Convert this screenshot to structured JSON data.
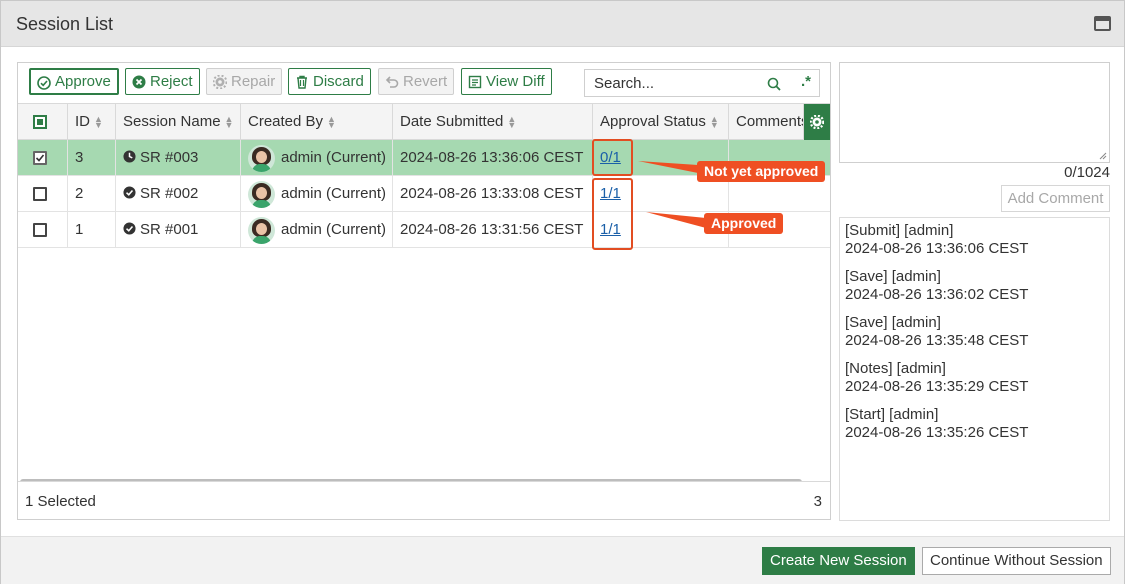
{
  "window": {
    "title": "Session List"
  },
  "toolbar": {
    "approve": "Approve",
    "reject": "Reject",
    "repair": "Repair",
    "discard": "Discard",
    "revert": "Revert",
    "view_diff": "View Diff",
    "search_placeholder": "Search...",
    "accent_color": "#2e7d46"
  },
  "table": {
    "columns": [
      "ID",
      "Session Name",
      "Created By",
      "Date Submitted",
      "Approval Status",
      "Comments"
    ],
    "rows": [
      {
        "selected": true,
        "id": "3",
        "session": "SR #003",
        "session_icon": "clock-icon",
        "created_by": "admin (Current)",
        "date": "2024-08-26 13:36:06 CEST",
        "approval": "0/1"
      },
      {
        "selected": false,
        "id": "2",
        "session": "SR #002",
        "session_icon": "check-circle-icon",
        "created_by": "admin (Current)",
        "date": "2024-08-26 13:33:08 CEST",
        "approval": "1/1"
      },
      {
        "selected": false,
        "id": "1",
        "session": "SR #001",
        "session_icon": "check-circle-icon",
        "created_by": "admin (Current)",
        "date": "2024-08-26 13:31:56 CEST",
        "approval": "1/1"
      }
    ],
    "footer_selected": "1 Selected",
    "footer_count": "3"
  },
  "annotations": {
    "not_approved": "Not yet approved",
    "approved": "Approved",
    "color": "#ef4f23"
  },
  "comments": {
    "counter": "0/1024",
    "add_button": "Add Comment",
    "log": [
      {
        "action": "[Submit] [admin]",
        "time": "2024-08-26 13:36:06 CEST"
      },
      {
        "action": "[Save] [admin]",
        "time": "2024-08-26 13:36:02 CEST"
      },
      {
        "action": "[Save] [admin]",
        "time": "2024-08-26 13:35:48 CEST"
      },
      {
        "action": "[Notes] [admin]",
        "time": "2024-08-26 13:35:29 CEST"
      },
      {
        "action": "[Start] [admin]",
        "time": "2024-08-26 13:35:26 CEST"
      }
    ]
  },
  "bottom": {
    "create": "Create New Session",
    "continue": "Continue Without Session"
  }
}
